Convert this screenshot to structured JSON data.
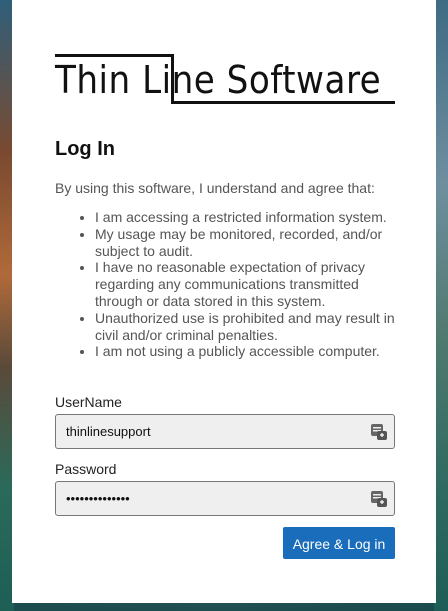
{
  "brand": {
    "logo_text": "Thin Line Software"
  },
  "login": {
    "title": "Log In",
    "intro": "By using this software, I understand and agree that:",
    "terms": [
      "I am accessing a restricted information system.",
      "My usage may be monitored, recorded, and/or subject to audit.",
      "I have no reasonable expectation of privacy regarding any communications transmitted through or data stored in this system.",
      "Unauthorized use is prohibited and may result in civil and/or criminal penalties.",
      "I am not using a publicly accessible computer."
    ],
    "username_label": "UserName",
    "username_value": "thinlinesupport",
    "password_label": "Password",
    "password_value": "••••••••••••••",
    "submit_label": "Agree & Log in"
  },
  "icons": {
    "field_icon": "password-manager-icon"
  },
  "colors": {
    "accent": "#1a6dbb",
    "field_bg": "#efefef"
  }
}
